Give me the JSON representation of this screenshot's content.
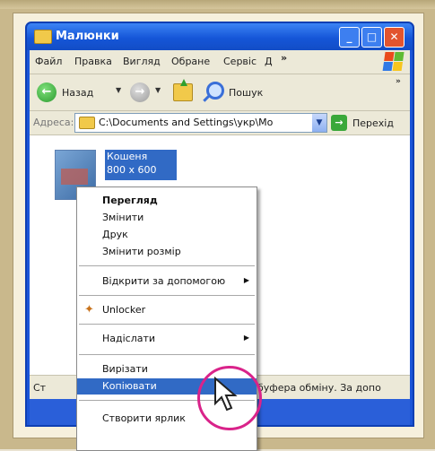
{
  "window": {
    "title": "Малюнки",
    "min": "_",
    "max": "□",
    "close": "✕"
  },
  "menubar": {
    "items": [
      "Файл",
      "Правка",
      "Вигляд",
      "Обране",
      "Сервіс",
      "Д"
    ],
    "overflow": "»"
  },
  "toolbar": {
    "back_label": "Назад",
    "search_label": "Пошук",
    "overflow": "»"
  },
  "address": {
    "label": "Адреса:",
    "value": "C:\\Documents and Settings\\укр\\Мо",
    "go_label": "Перехід"
  },
  "file": {
    "name": "Кошеня",
    "size": "800 x 600"
  },
  "context_menu": {
    "items": [
      {
        "label": "Перегляд"
      },
      {
        "label": "Змінити"
      },
      {
        "label": "Друк"
      },
      {
        "label": "Змінити розмір"
      },
      {
        "label": "Відкрити за допомогою"
      },
      {
        "label": "Unlocker"
      },
      {
        "label": "Надіслати"
      },
      {
        "label": "Вирізати"
      },
      {
        "label": "Копіювати"
      },
      {
        "label": "Створити ярлик"
      }
    ]
  },
  "status": {
    "left": "Ст",
    "right": "буфера обміну. За допо"
  },
  "colors": {
    "xp_blue": "#2a5fd9",
    "selection": "#316ac5",
    "highlight_ring": "#d9238a"
  },
  "icons": [
    "folder-icon",
    "back-arrow-icon",
    "forward-arrow-icon",
    "folder-up-icon",
    "search-icon",
    "go-arrow-icon",
    "unlocker-icon",
    "pointer-cursor-icon"
  ]
}
